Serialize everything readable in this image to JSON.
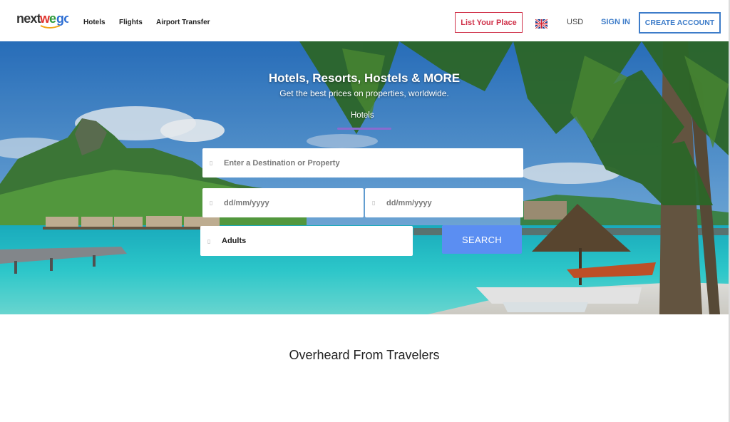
{
  "brand": {
    "logo_text": "nextwego"
  },
  "nav": {
    "hotels": "Hotels",
    "flights": "Flights",
    "airport_transfer": "Airport Transfer"
  },
  "header": {
    "list_place": "List Your Place",
    "currency": "USD",
    "sign_in": "SIGN IN",
    "create_account": "CREATE ACCOUNT",
    "flag_icon": "uk-flag-icon"
  },
  "hero": {
    "title": "Hotels, Resorts, Hostels & MORE",
    "subtitle": "Get the best prices on properties, worldwide.",
    "active_tab": "Hotels"
  },
  "search": {
    "destination_placeholder": "Enter a Destination or Property",
    "checkin_placeholder": "dd/mm/yyyy",
    "checkout_placeholder": "dd/mm/yyyy",
    "guests_label": "Adults",
    "button": "SEARCH"
  },
  "sections": {
    "travelers_title": "Overheard From Travelers"
  },
  "colors": {
    "accent_blue": "#3d7cc9",
    "list_place_red": "#d0324a",
    "search_button": "#5b8ef2",
    "tab_underline": "#8a6bd0"
  }
}
